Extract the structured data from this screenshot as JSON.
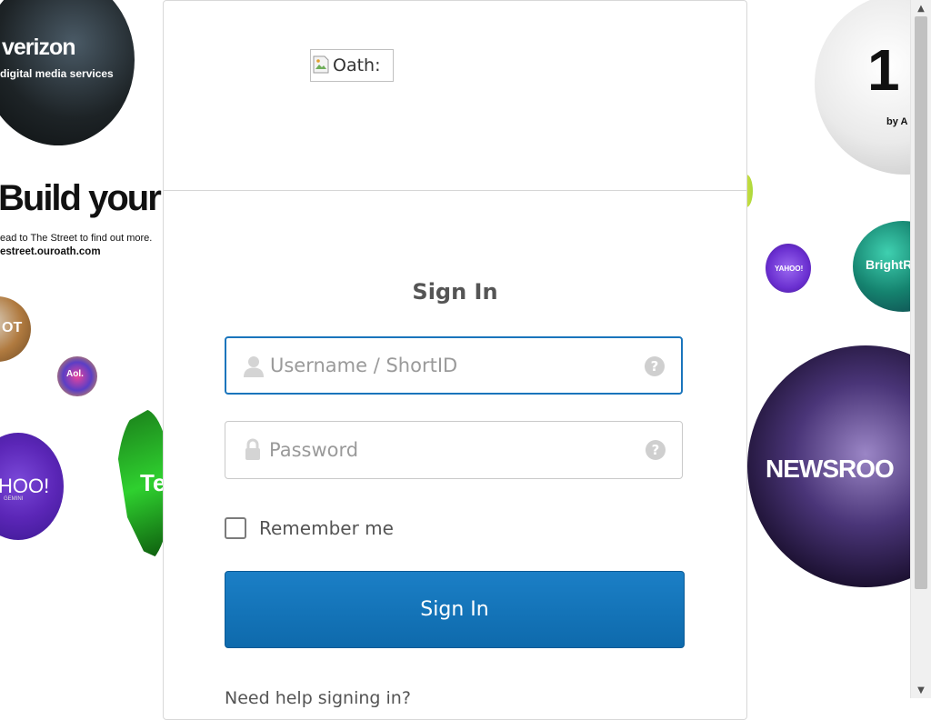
{
  "background": {
    "verizon_logo": "verizon",
    "verizon_tagline": "digital media services",
    "build_headline": "Build your",
    "build_line1": "ead to The Street to find out more.",
    "build_line2": "estreet.ouroath.com",
    "small_globe_text": "OT",
    "aol_text": "Aol.",
    "yahoo_text": "HOO!",
    "yahoo_sub": "GEMINI",
    "green_text": "Te",
    "oneby_text": "1",
    "oneby_sub": "by A",
    "yahoo2_text": "YAHOO!",
    "bright_text": "BrightR",
    "news_text": "NEWSROO"
  },
  "header": {
    "logo_alt": "Oath:"
  },
  "form": {
    "title": "Sign In",
    "username": {
      "value": "",
      "placeholder": "Username / ShortID"
    },
    "password": {
      "value": "",
      "placeholder": "Password"
    },
    "help_glyph": "?",
    "remember_label": "Remember me",
    "remember_checked": false,
    "submit_label": "Sign In",
    "help_link": "Need help signing in?"
  },
  "scrollbar": {
    "up_glyph": "▲",
    "down_glyph": "▼"
  },
  "colors": {
    "primary": "#0e6aac",
    "focus_border": "#1a75bc",
    "title_text": "#555555"
  }
}
